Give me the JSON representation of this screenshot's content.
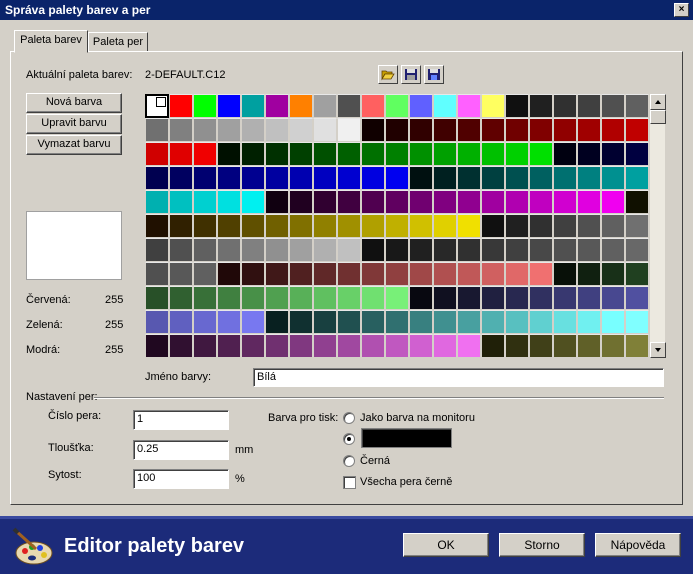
{
  "window": {
    "title": "Správa palety barev a per",
    "close_glyph": "×"
  },
  "tabs": [
    {
      "label": "Paleta barev"
    },
    {
      "label": "Paleta per"
    }
  ],
  "palette": {
    "current_label": "Aktuální paleta barev:",
    "current_value": "2-DEFAULT.C12"
  },
  "icons": {
    "open": "open-folder-icon",
    "save": "save-icon",
    "save_as": "save-as-icon"
  },
  "buttons": {
    "new_color": "Nová barva",
    "edit_color": "Upravit barvu",
    "delete_color": "Vymazat barvu"
  },
  "preview_color": "#ffffff",
  "rgb": {
    "red_label": "Červená:",
    "red_value": "255",
    "green_label": "Zelená:",
    "green_value": "255",
    "blue_label": "Modrá:",
    "blue_value": "255"
  },
  "color_name": {
    "label": "Jméno barvy:",
    "value": "Bílá"
  },
  "pen_settings": {
    "section_label": "Nastavení per:",
    "pen_number_label": "Číslo pera:",
    "pen_number_value": "1",
    "thickness_label": "Tloušťka:",
    "thickness_value": "0.25",
    "thickness_unit": "mm",
    "intensity_label": "Sytost:",
    "intensity_value": "100",
    "intensity_unit": "%",
    "print_color_label": "Barva pro tisk:",
    "option_monitor": "Jako barva na monitoru",
    "option_custom_color": "#000000",
    "option_black": "Černá",
    "selected_option": "custom",
    "all_black_label": "Všecha pera černě",
    "all_black_checked": false
  },
  "palette_colors": [
    [
      "#ffffff",
      "#ff0000",
      "#00ff00",
      "#0000ff",
      "#00a0a0",
      "#a000a0",
      "#ff8000",
      "#a0a0a0",
      "#505050",
      "#ff6060",
      "#60ff60",
      "#6060ff",
      "#60ffff",
      "#ff60ff",
      "#ffff60",
      "#101010",
      "#202020",
      "#303030",
      "#404040",
      "#505050",
      "#606060"
    ],
    [
      "#707070",
      "#808080",
      "#909090",
      "#a0a0a0",
      "#b0b0b0",
      "#c0c0c0",
      "#d0d0d0",
      "#e0e0e0",
      "#f0f0f0",
      "#100000",
      "#200000",
      "#300000",
      "#400000",
      "#500000",
      "#600000",
      "#700000",
      "#800000",
      "#900000",
      "#a00000",
      "#b00000",
      "#c00000"
    ],
    [
      "#d00000",
      "#e00000",
      "#f00000",
      "#001000",
      "#002000",
      "#003000",
      "#004000",
      "#005000",
      "#006000",
      "#007000",
      "#008000",
      "#009000",
      "#00a000",
      "#00b000",
      "#00c000",
      "#00d000",
      "#00e000",
      "#000010",
      "#000020",
      "#000030",
      "#000040"
    ],
    [
      "#000050",
      "#000060",
      "#000070",
      "#000080",
      "#000090",
      "#0000a0",
      "#0000b0",
      "#0000c0",
      "#0000d0",
      "#0000e0",
      "#0000f0",
      "#001010",
      "#002020",
      "#003030",
      "#004040",
      "#005050",
      "#006060",
      "#007070",
      "#008080",
      "#009090",
      "#00a0a0"
    ],
    [
      "#00b0b0",
      "#00c0c0",
      "#00d0d0",
      "#00e0e0",
      "#00f0f0",
      "#100010",
      "#200020",
      "#300030",
      "#400040",
      "#500050",
      "#600060",
      "#700070",
      "#800080",
      "#900090",
      "#a000a0",
      "#b000b0",
      "#c000c0",
      "#d000d0",
      "#e000e0",
      "#f000f0",
      "#101000"
    ],
    [
      "#201000",
      "#302000",
      "#403000",
      "#504000",
      "#605000",
      "#706000",
      "#807000",
      "#908000",
      "#a09000",
      "#b0a000",
      "#c0b000",
      "#d0c000",
      "#e0d000",
      "#f0e000",
      "#101010",
      "#202020",
      "#303030",
      "#404040",
      "#505050",
      "#606060",
      "#707070"
    ],
    [
      "#404040",
      "#505050",
      "#606060",
      "#707070",
      "#808080",
      "#909090",
      "#a0a0a0",
      "#b0b0b0",
      "#c0c0c0",
      "#101010",
      "#181818",
      "#202020",
      "#282828",
      "#303030",
      "#383838",
      "#404040",
      "#484848",
      "#505050",
      "#585858",
      "#606060",
      "#686868"
    ],
    [
      "#505050",
      "#585858",
      "#606060",
      "#200808",
      "#301010",
      "#401818",
      "#502020",
      "#602828",
      "#703030",
      "#803838",
      "#904040",
      "#a04848",
      "#b05050",
      "#c05858",
      "#d06060",
      "#e06868",
      "#f07070",
      "#081008",
      "#102010",
      "#183018",
      "#204020"
    ],
    [
      "#285028",
      "#306030",
      "#387038",
      "#408040",
      "#489048",
      "#50a050",
      "#58b058",
      "#60c060",
      "#68d068",
      "#70e070",
      "#78f078",
      "#080810",
      "#101020",
      "#181830",
      "#202040",
      "#282850",
      "#303060",
      "#383870",
      "#404080",
      "#484890",
      "#5050a0"
    ],
    [
      "#5858b0",
      "#6060c0",
      "#6868d0",
      "#7070e0",
      "#7878f0",
      "#082020",
      "#103030",
      "#184040",
      "#205050",
      "#286060",
      "#307070",
      "#388080",
      "#409090",
      "#48a0a0",
      "#50b0b0",
      "#58c0c0",
      "#60d0d0",
      "#68e0e0",
      "#70f0f0",
      "#78ffff",
      "#80ffff"
    ],
    [
      "#200820",
      "#301030",
      "#401840",
      "#502050",
      "#602860",
      "#703070",
      "#803880",
      "#904090",
      "#a048a0",
      "#b050b0",
      "#c058c0",
      "#d060d0",
      "#e068e0",
      "#f070f0",
      "#202008",
      "#303010",
      "#404018",
      "#505020",
      "#606028",
      "#707030",
      "#808038"
    ]
  ],
  "footer": {
    "app_title": "Editor palety barev",
    "logo_icon": "palette-brush-icon",
    "ok_label": "OK",
    "cancel_label": "Storno",
    "help_label": "Nápověda"
  }
}
